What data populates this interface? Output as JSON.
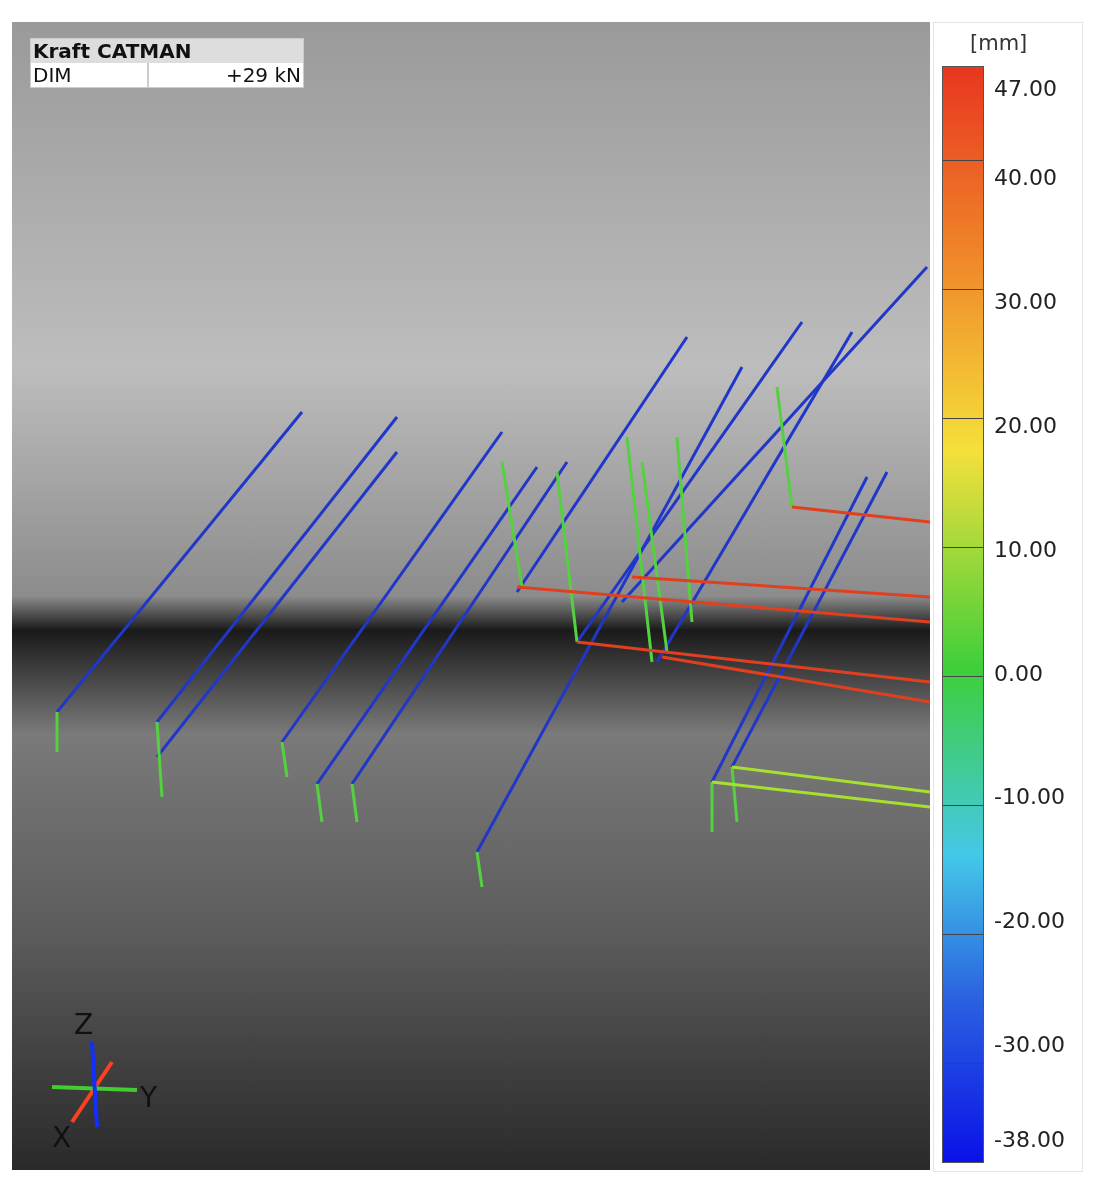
{
  "info_box": {
    "title": "Kraft CATMAN",
    "rows": [
      {
        "label": "DIM",
        "value": "+29 kN"
      }
    ]
  },
  "axis_triad": {
    "labels": [
      "Z",
      "Y",
      "X"
    ]
  },
  "color_legend": {
    "unit": "[mm]",
    "ticks": [
      "47.00",
      "40.00",
      "30.00",
      "20.00",
      "10.00",
      "0.00",
      "-10.00",
      "-20.00",
      "-30.00",
      "-38.00"
    ]
  }
}
